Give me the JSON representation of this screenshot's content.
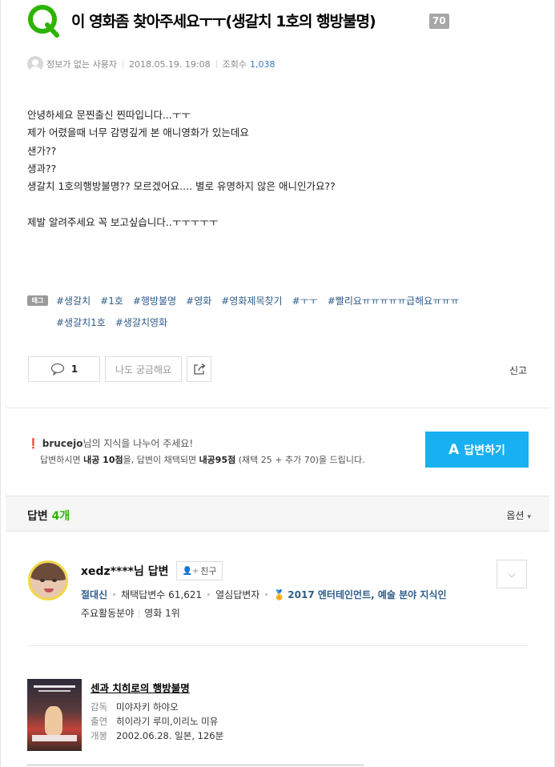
{
  "question": {
    "title": "이 영화좀 찾아주세요ㅜㅜ(생갈치 1호의 행방불명)",
    "bounty": "70",
    "author": "정보가 없는 사용자",
    "date": "2018.05.19. 19:08",
    "views_label": "조회수",
    "views": "1,038",
    "body_lines": [
      "안녕하세요 문찐출신 찐따입니다...ㅜㅜ",
      "제가 어렸을때 너무 감명깊게 본 애니영화가 있는데요",
      "샌가??",
      "생과??",
      "생갈치 1호의행방불명?? 모르겠어요.... 별로 유명하지 않은 애니인가요??",
      "",
      "제발 알려주세요 꼭 보고싶습니다..ㅜㅜㅜㅜㅜ"
    ],
    "tag_label": "태그",
    "tags": [
      "#생갈치",
      "#1호",
      "#행방불명",
      "#영화",
      "#영화제목찾기",
      "#ㅜㅜ",
      "#빨리요ㅠㅠㅠㅠㅠ급해요ㅠㅠㅠ",
      "#생갈치1호",
      "#생갈치영화"
    ],
    "comment_count": "1",
    "curious_label": "나도 궁금해요",
    "report_label": "신고"
  },
  "share": {
    "user": "brucejo",
    "line1_suffix": "님의 지식을 나누어 주세요!",
    "line2_a": "답변하시면 ",
    "line2_b": "내공 10점",
    "line2_c": "을, 답변이 채택되면 ",
    "line2_d": "내공95점",
    "line2_e": " (채택 25 + 추가 70)을 드립니다.",
    "answer_button": "답변하기"
  },
  "answers": {
    "label": "답변",
    "count": "4개",
    "options_label": "옵션"
  },
  "answer": {
    "user": "xedz****님 답변",
    "friend_label": "친구",
    "grade": "절대신",
    "adopted": "채택답변수 61,621",
    "badge": "열심답변자",
    "award": "2017 엔터테인먼트, 예술 분야 지식인",
    "field_label": "주요활동분야",
    "field_value": "영화 1위"
  },
  "movie": {
    "title": "센과 치히로의 행방불명",
    "director_label": "감독",
    "director": "미야자키 하야오",
    "cast_label": "출연",
    "cast": "히이라기 루미,이리노 미유",
    "release_label": "개봉",
    "release": "2002.06.28. 일본, 126분"
  },
  "colors": {
    "logo_green": "#2db400",
    "answer_button": "#18b0f0",
    "tag_link": "#2f5d8a",
    "count_green": "#2db400"
  }
}
